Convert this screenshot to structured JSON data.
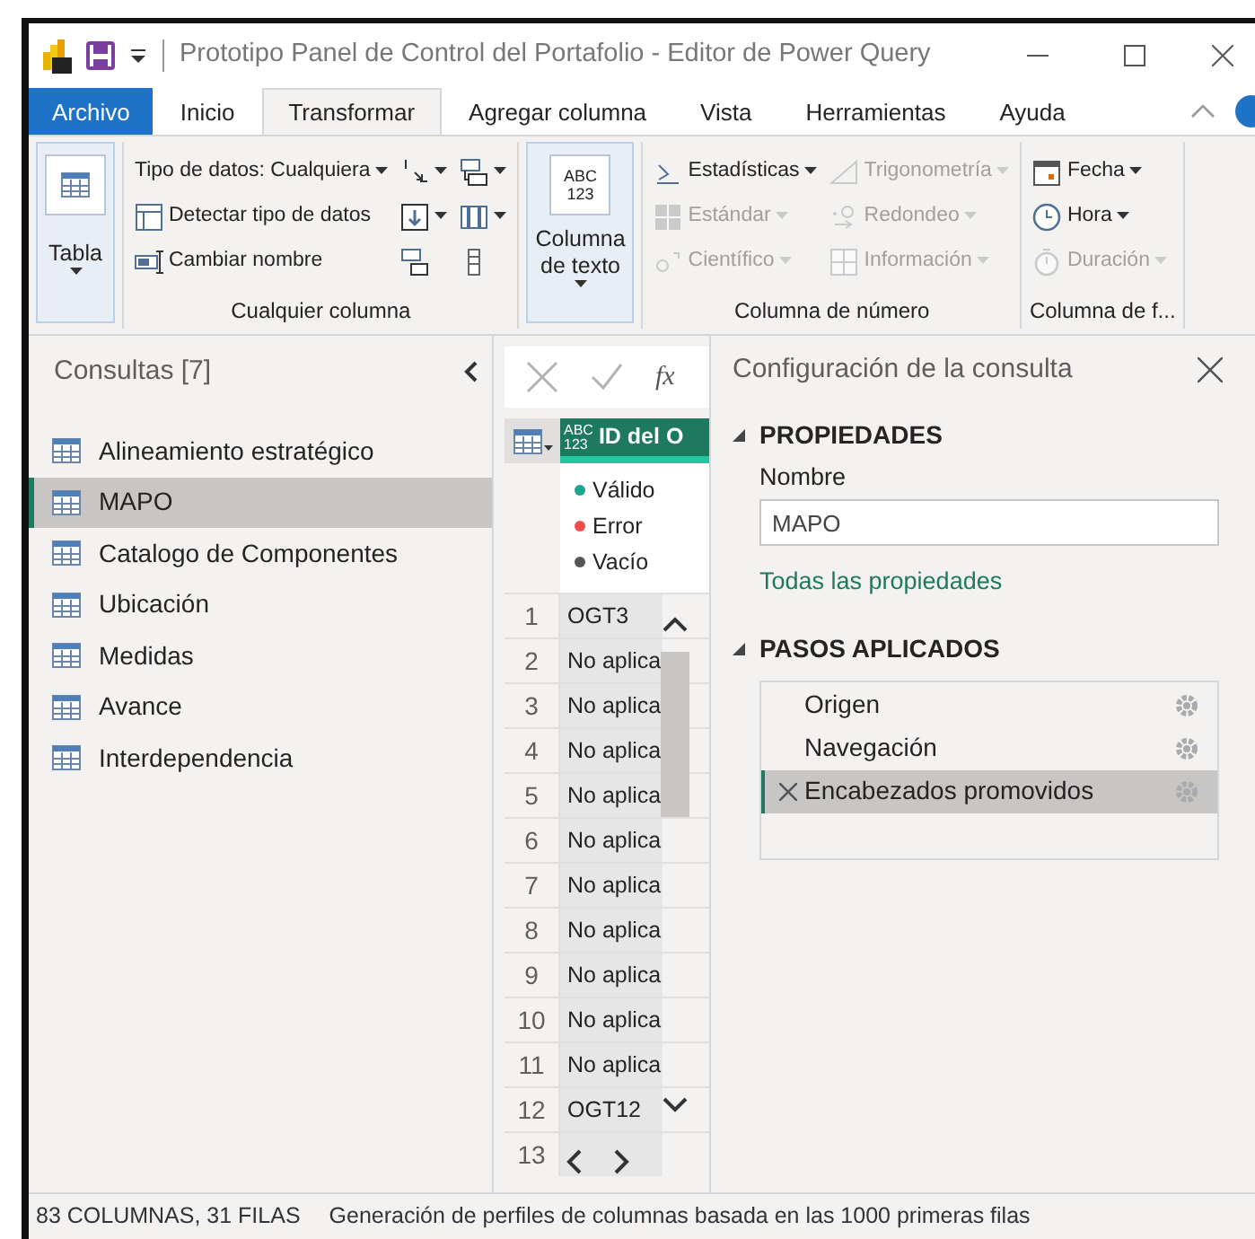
{
  "window": {
    "title": "Prototipo Panel de Control del Portafolio - Editor de Power Query"
  },
  "ribbon_tabs": [
    {
      "label": "Archivo",
      "kind": "file",
      "selected": false
    },
    {
      "label": "Inicio",
      "kind": "tab",
      "selected": false
    },
    {
      "label": "Transformar",
      "kind": "tab",
      "selected": true
    },
    {
      "label": "Agregar columna",
      "kind": "tab",
      "selected": false
    },
    {
      "label": "Vista",
      "kind": "tab",
      "selected": false
    },
    {
      "label": "Herramientas",
      "kind": "tab",
      "selected": false
    },
    {
      "label": "Ayuda",
      "kind": "tab",
      "selected": false
    }
  ],
  "ribbon_groups": [
    {
      "buttons": [
        {
          "kind": "large",
          "label": "Tabla",
          "dropdown": true,
          "disabled": false
        }
      ]
    },
    {
      "label": "Cualquier columna",
      "buttons": [
        {
          "kind": "small",
          "label": "Tipo de datos: Cualquiera",
          "dropdown": true,
          "disabled": false
        },
        {
          "kind": "small",
          "label": "Detectar tipo de datos",
          "dropdown": false,
          "disabled": false
        },
        {
          "kind": "small",
          "label": "Cambiar nombre",
          "dropdown": false,
          "disabled": false
        },
        {
          "kind": "icon",
          "dropdown": true,
          "disabled": false
        },
        {
          "kind": "icon",
          "dropdown": true,
          "disabled": false
        },
        {
          "kind": "icon",
          "dropdown": false,
          "disabled": false
        },
        {
          "kind": "icon",
          "dropdown": true,
          "disabled": false
        },
        {
          "kind": "icon",
          "dropdown": true,
          "disabled": false
        },
        {
          "kind": "icon",
          "dropdown": false,
          "disabled": false
        }
      ]
    },
    {
      "buttons": [
        {
          "kind": "large",
          "label": "Columna de texto",
          "icon_text": [
            "ABC",
            "123"
          ],
          "dropdown": true,
          "disabled": false
        }
      ]
    },
    {
      "label": "Columna de número",
      "buttons": [
        {
          "kind": "small",
          "label": "Estadísticas",
          "dropdown": true,
          "disabled": false
        },
        {
          "kind": "small",
          "label": "Estándar",
          "dropdown": true,
          "disabled": true
        },
        {
          "kind": "small",
          "label": "Científico",
          "dropdown": true,
          "disabled": true
        },
        {
          "kind": "small",
          "label": "Trigonometría",
          "dropdown": true,
          "disabled": true
        },
        {
          "kind": "small",
          "label": "Redondeo",
          "dropdown": true,
          "disabled": true
        },
        {
          "kind": "small",
          "label": "Información",
          "dropdown": true,
          "disabled": true
        }
      ]
    },
    {
      "label": "Columna de f...",
      "buttons": [
        {
          "kind": "small",
          "label": "Fecha",
          "dropdown": true,
          "disabled": false
        },
        {
          "kind": "small",
          "label": "Hora",
          "dropdown": true,
          "disabled": false
        },
        {
          "kind": "small",
          "label": "Duración",
          "dropdown": true,
          "disabled": true
        }
      ]
    }
  ],
  "queries": {
    "title": "Consultas [7]",
    "items": [
      {
        "label": "Alineamiento estratégico",
        "selected": false
      },
      {
        "label": "MAPO",
        "selected": true
      },
      {
        "label": "Catalogo de Componentes",
        "selected": false
      },
      {
        "label": "Ubicación",
        "selected": false
      },
      {
        "label": "Medidas",
        "selected": false
      },
      {
        "label": "Avance",
        "selected": false
      },
      {
        "label": "Interdependencia",
        "selected": false
      }
    ]
  },
  "formula_bar": {
    "label": "fx"
  },
  "grid": {
    "column": {
      "type": [
        "ABC",
        "123"
      ],
      "header": "ID del O"
    },
    "quality": [
      {
        "label": "Válido",
        "color": "#1aa68f"
      },
      {
        "label": "Error",
        "color": "#f04e4e"
      },
      {
        "label": "Vacío",
        "color": "#555555"
      }
    ],
    "rows": [
      {
        "number": "1",
        "value": "OGT3"
      },
      {
        "number": "2",
        "value": "No aplica"
      },
      {
        "number": "3",
        "value": "No aplica"
      },
      {
        "number": "4",
        "value": "No aplica"
      },
      {
        "number": "5",
        "value": "No aplica"
      },
      {
        "number": "6",
        "value": "No aplica"
      },
      {
        "number": "7",
        "value": "No aplica"
      },
      {
        "number": "8",
        "value": "No aplica"
      },
      {
        "number": "9",
        "value": "No aplica"
      },
      {
        "number": "10",
        "value": "No aplica"
      },
      {
        "number": "11",
        "value": "No aplica"
      },
      {
        "number": "12",
        "value": "OGT12"
      },
      {
        "number": "13"
      }
    ]
  },
  "settings": {
    "title": "Configuración de la consulta",
    "properties": {
      "heading": "PROPIEDADES",
      "expanded": true,
      "name_label": "Nombre",
      "name_value": "MAPO",
      "link": "Todas las propiedades"
    },
    "steps": {
      "heading": "PASOS APLICADOS",
      "expanded": true,
      "items": [
        {
          "label": "Origen",
          "selected": false
        },
        {
          "label": "Navegación",
          "selected": false
        },
        {
          "label": "Encabezados promovidos",
          "selected": true
        }
      ]
    }
  },
  "status_bar": {
    "summary": "83 COLUMNAS, 31 FILAS",
    "profiling": "Generación de perfiles de columnas basada en las 1000 primeras filas"
  }
}
